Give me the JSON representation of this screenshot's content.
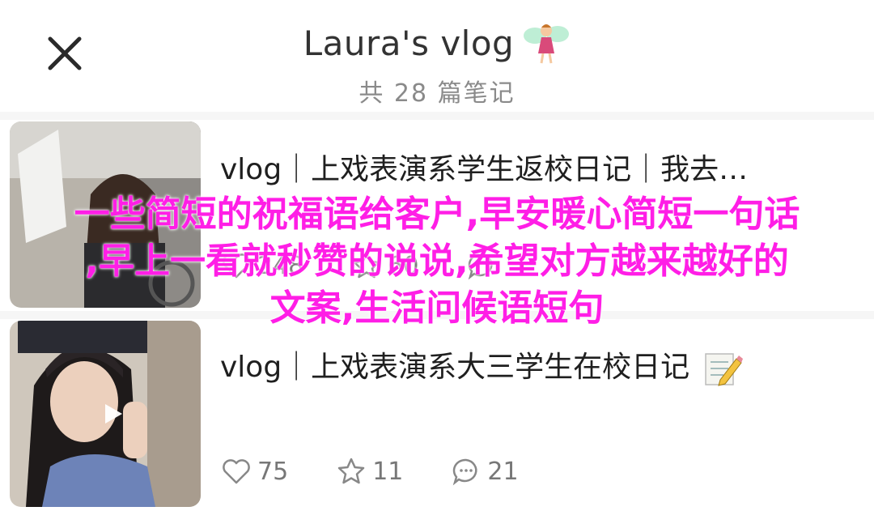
{
  "header": {
    "title": "Laura's vlog",
    "title_icon": "fairy-emoji",
    "subtitle": "共 28 篇笔记",
    "close_icon": "close-icon"
  },
  "notes": [
    {
      "title": "vlog｜上戏表演系学生返校日记｜我去…",
      "likes": "248",
      "favorites": "60",
      "comments": ""
    },
    {
      "title": "vlog｜上戏表演系大三学生在校日记",
      "title_icon": "memo-pencil-emoji",
      "likes": "75",
      "favorites": "11",
      "comments": "21"
    }
  ],
  "overlay": {
    "line1": "一些简短的祝福语给客户,早安暖心简短一句话",
    "line2": ",早上一看就秒赞的说说,希望对方越来越好的",
    "line3": "文案,生活问候语短句"
  },
  "colors": {
    "overlay_text": "#ff1ee6",
    "list_background": "#f6f6f6",
    "subtitle": "#8a8a8a"
  }
}
